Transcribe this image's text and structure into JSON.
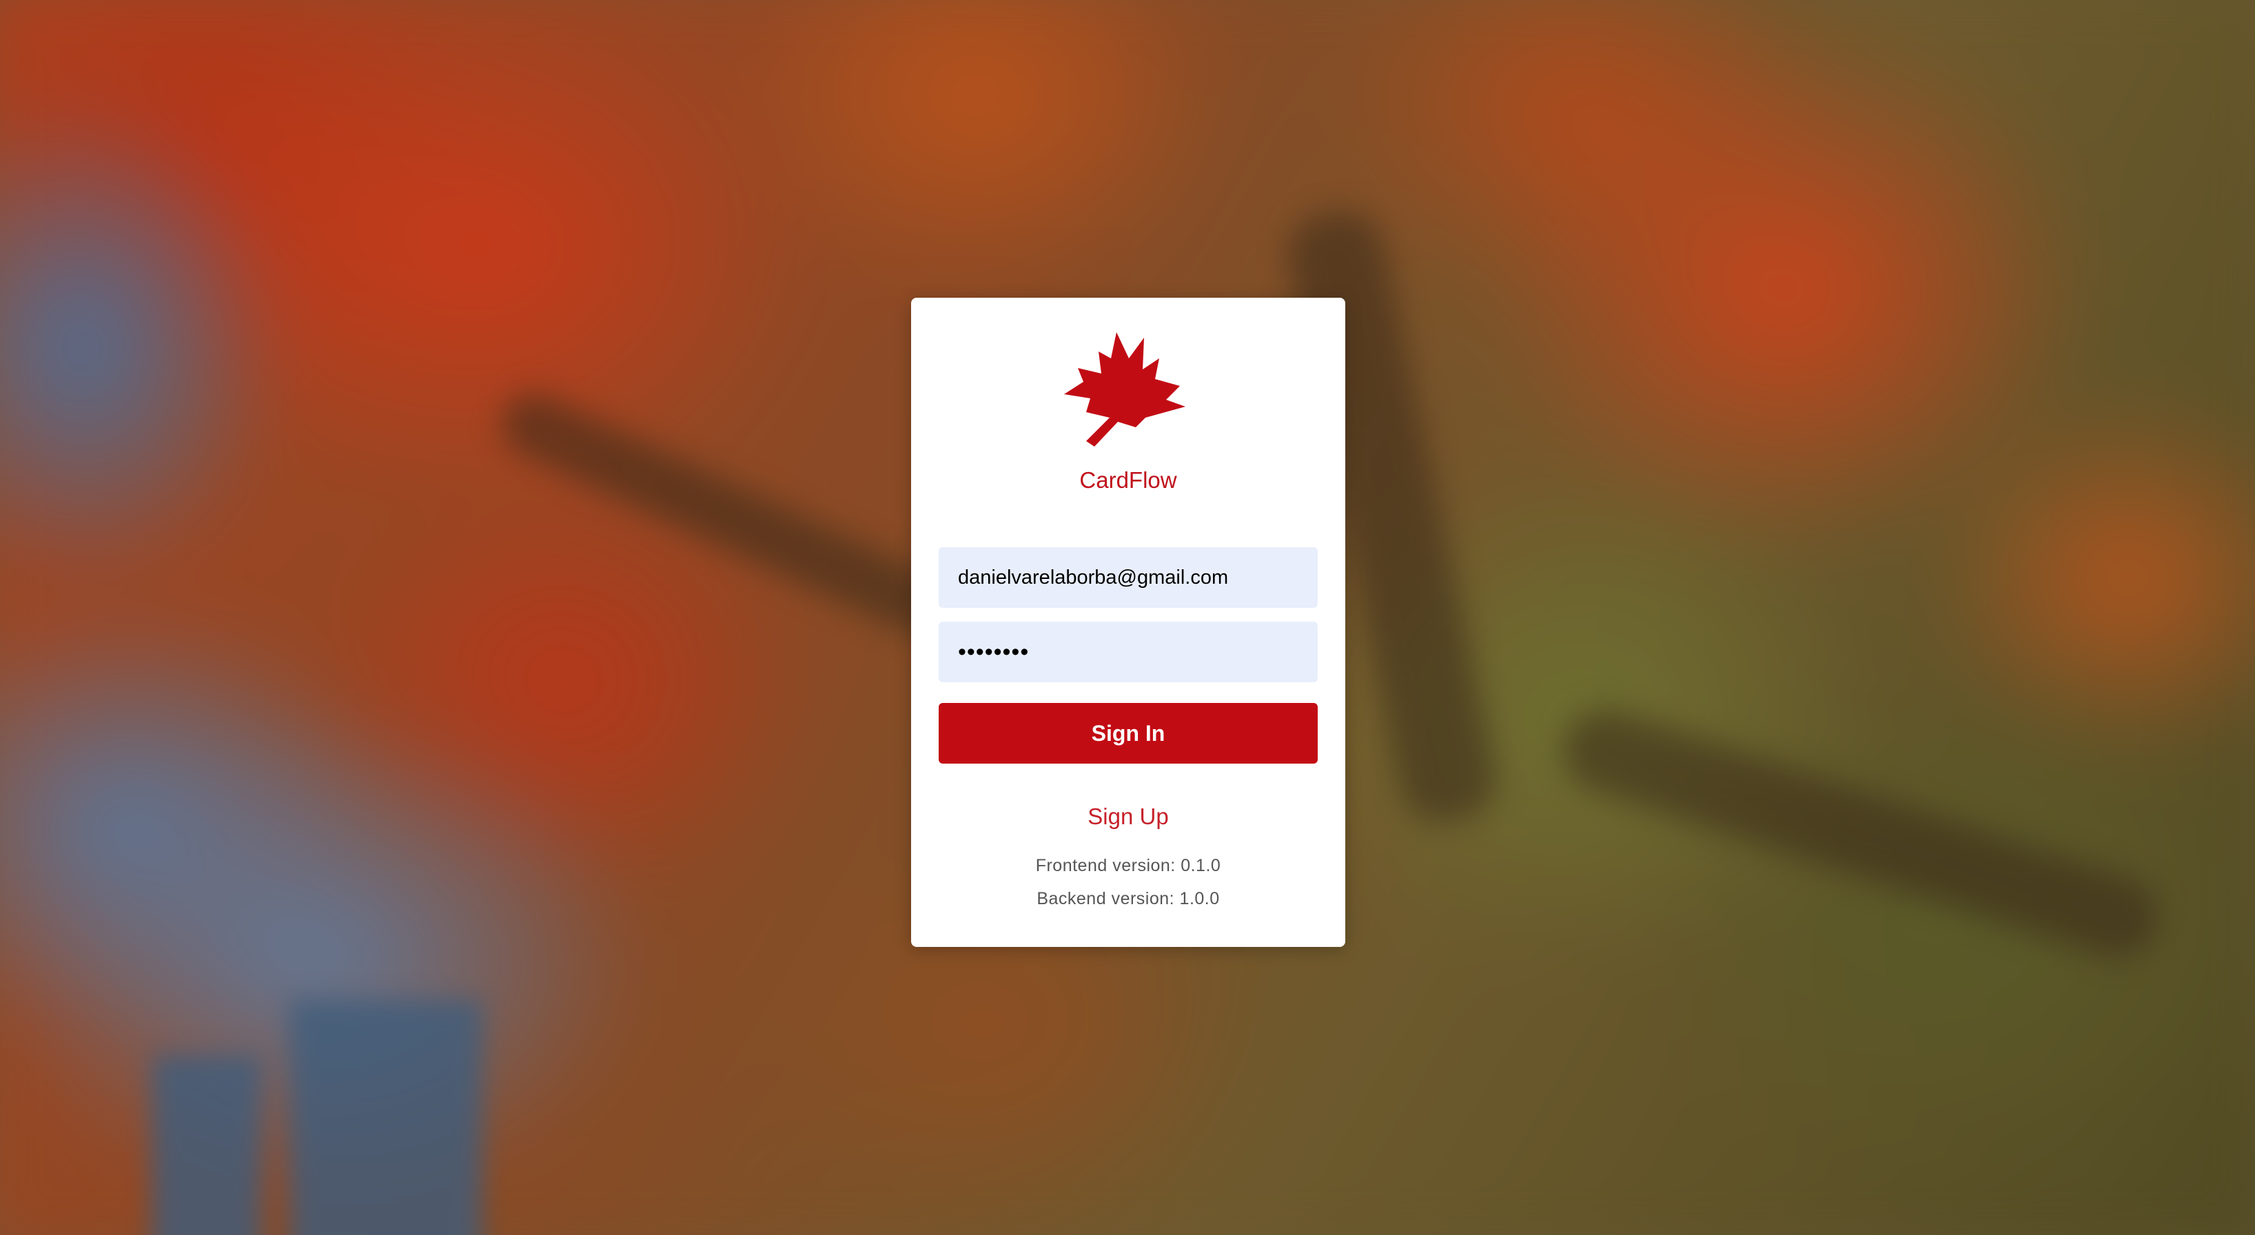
{
  "app": {
    "name": "CardFlow",
    "brand_color": "#c20c14",
    "logo_icon": "maple-leaf-icon"
  },
  "login": {
    "email_value": "danielvarelaborba@gmail.com",
    "password_value": "••••••••",
    "sign_in_label": "Sign In",
    "sign_up_label": "Sign Up"
  },
  "versions": {
    "frontend": "Frontend version: 0.1.0",
    "backend": "Backend version: 1.0.0"
  },
  "colors": {
    "input_background": "#e8eefb",
    "card_background": "#ffffff"
  }
}
